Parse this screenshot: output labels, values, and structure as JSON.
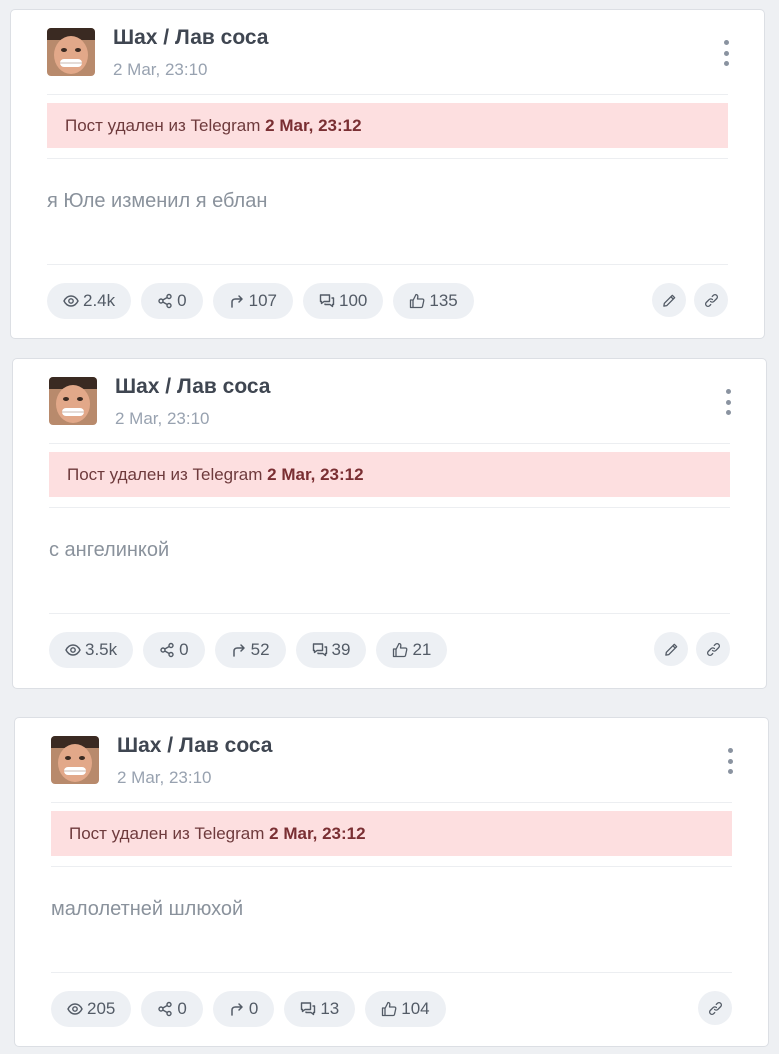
{
  "posts": [
    {
      "author": "Шах / Лав соса",
      "date": "2 Mar, 23:10",
      "deleted_prefix": "Пост удален из Telegram",
      "deleted_date": "2 Mar, 23:12",
      "text": "я Юле изменил я еблан",
      "views": "2.4k",
      "shares": "0",
      "forwards": "107",
      "comments": "100",
      "likes": "135",
      "editable": true
    },
    {
      "author": "Шах / Лав соса",
      "date": "2 Mar, 23:10",
      "deleted_prefix": "Пост удален из Telegram",
      "deleted_date": "2 Mar, 23:12",
      "text": "с ангелинкой",
      "views": "3.5k",
      "shares": "0",
      "forwards": "52",
      "comments": "39",
      "likes": "21",
      "editable": true
    },
    {
      "author": "Шах / Лав соса",
      "date": "2 Mar, 23:10",
      "deleted_prefix": "Пост удален из Telegram",
      "deleted_date": "2 Mar, 23:12",
      "text": "малолетней шлюхой",
      "views": "205",
      "shares": "0",
      "forwards": "0",
      "comments": "13",
      "likes": "104",
      "editable": false
    }
  ],
  "icons": {
    "views": "eye-icon",
    "shares": "share-icon",
    "forwards": "forward-icon",
    "comments": "comments-icon",
    "likes": "thumbs-up-icon",
    "edit": "pencil-icon",
    "link": "link-icon",
    "menu": "more-vertical-icon"
  },
  "colors": {
    "alert_bg": "#fddfe0",
    "card_bg": "#ffffff",
    "page_bg": "#eef0f3"
  }
}
